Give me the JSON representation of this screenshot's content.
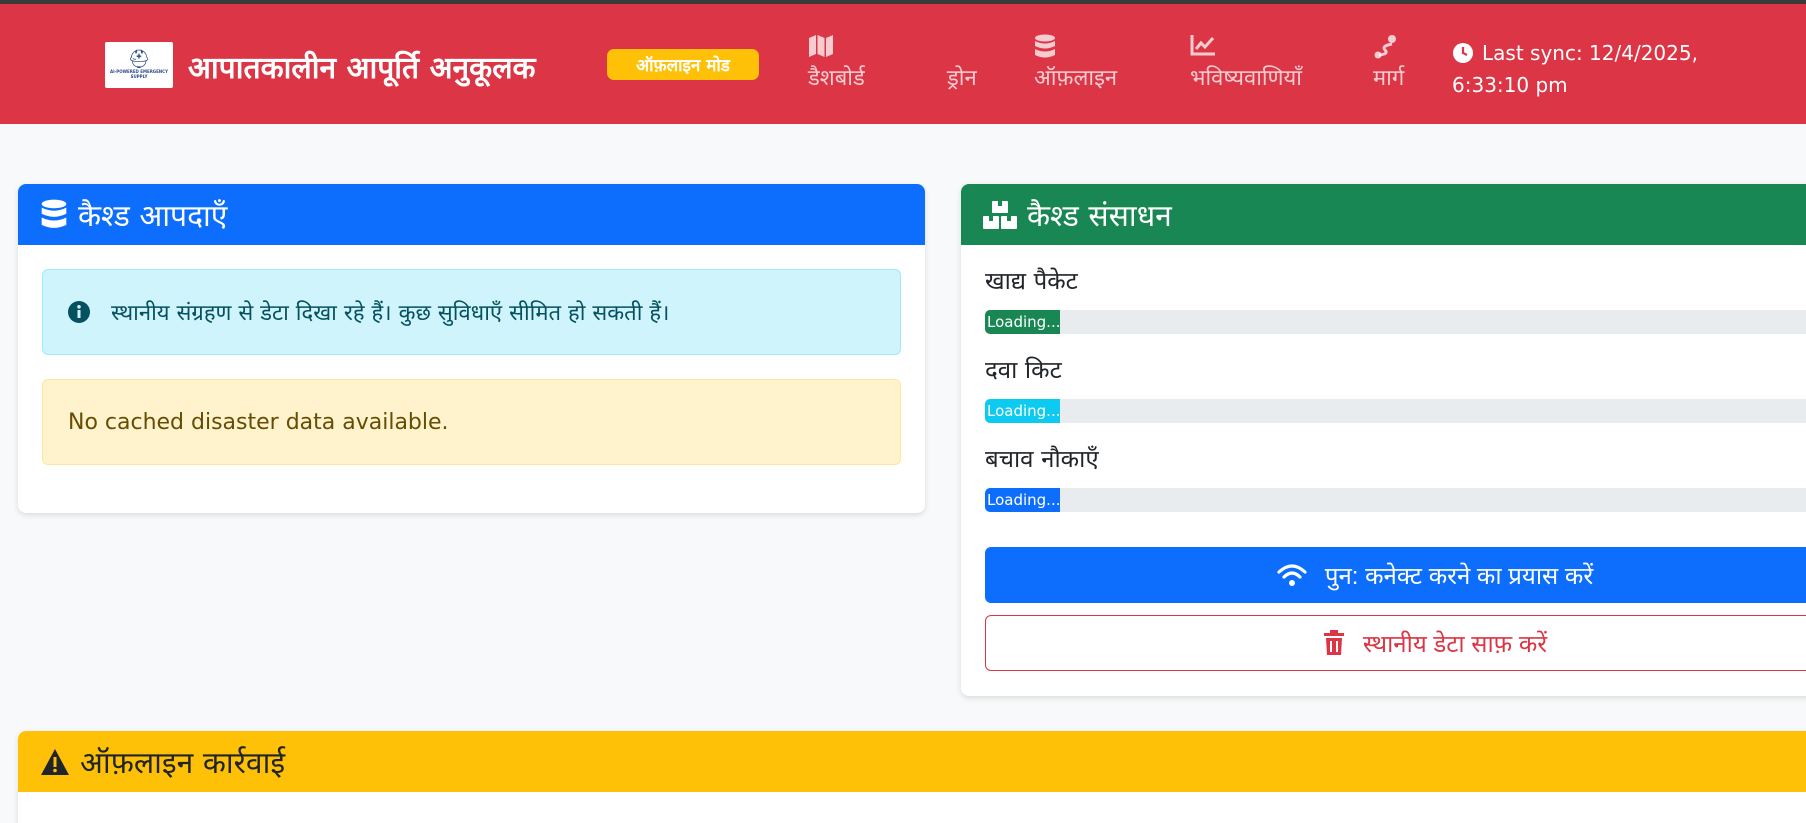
{
  "navbar": {
    "logo_text": "AI-POWERED EMERGENCY SUPPLY",
    "brand": "आपातकालीन आपूर्ति अनुकूलक",
    "mode_badge": "ऑफ़लाइन मोड",
    "items": [
      {
        "label": "डैशबोर्ड",
        "icon": "map-icon"
      },
      {
        "label": "ड्रोन",
        "icon": "drone-icon"
      },
      {
        "label": "ऑफ़लाइन",
        "icon": "database-icon"
      },
      {
        "label": "भविष्यवाणियाँ",
        "icon": "chart-line-icon"
      },
      {
        "label": "मार्ग",
        "icon": "route-icon"
      }
    ],
    "sync_text": "Last sync: 12/4/2025, 6:33:10 pm",
    "color": "#dc3545"
  },
  "disasters_card": {
    "title": "कैश्ड आपदाएँ",
    "header_color": "#0d6efd",
    "info_text": "स्थानीय संग्रहण से डेटा दिखा रहे हैं। कुछ सुविधाएँ सीमित हो सकती हैं।",
    "empty_text": "No cached disaster data available."
  },
  "resources_card": {
    "title": "कैश्ड संसाधन",
    "header_color": "#198754",
    "resources": [
      {
        "label": "खाद्य पैकेट",
        "status": "Loading...",
        "color": "#198754"
      },
      {
        "label": "दवा किट",
        "status": "Loading...",
        "color": "#0dcaf0"
      },
      {
        "label": "बचाव नौकाएँ",
        "status": "Loading...",
        "color": "#0d6efd"
      }
    ],
    "reconnect_label": "पुन: कनेक्ट करने का प्रयास करें",
    "clear_label": "स्थानीय डेटा साफ़ करें"
  },
  "actions_card": {
    "title": "ऑफ़लाइन कार्रवाई",
    "header_color": "#ffc107"
  }
}
